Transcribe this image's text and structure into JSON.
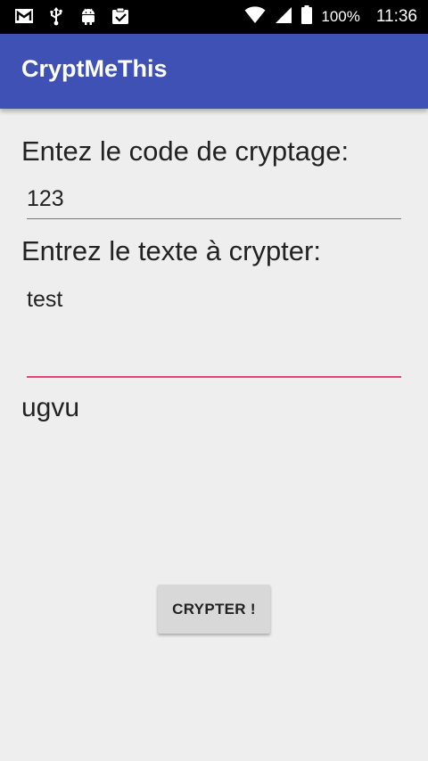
{
  "status_bar": {
    "icons_left": [
      "gmail-icon",
      "usb-icon",
      "android-debug-icon",
      "clipboard-check-icon"
    ],
    "battery": "100%",
    "time": "11:36"
  },
  "app_bar": {
    "title": "CryptMeThis"
  },
  "form": {
    "code_label": "Entez le code de cryptage:",
    "code_value": "123",
    "text_label": "Entrez le texte à crypter:",
    "text_value": "test",
    "result": "ugvu",
    "button_label": "CRYPTER !"
  },
  "colors": {
    "app_bar": "#3f51b5",
    "accent": "#ec407a",
    "background": "#eeeeee"
  }
}
